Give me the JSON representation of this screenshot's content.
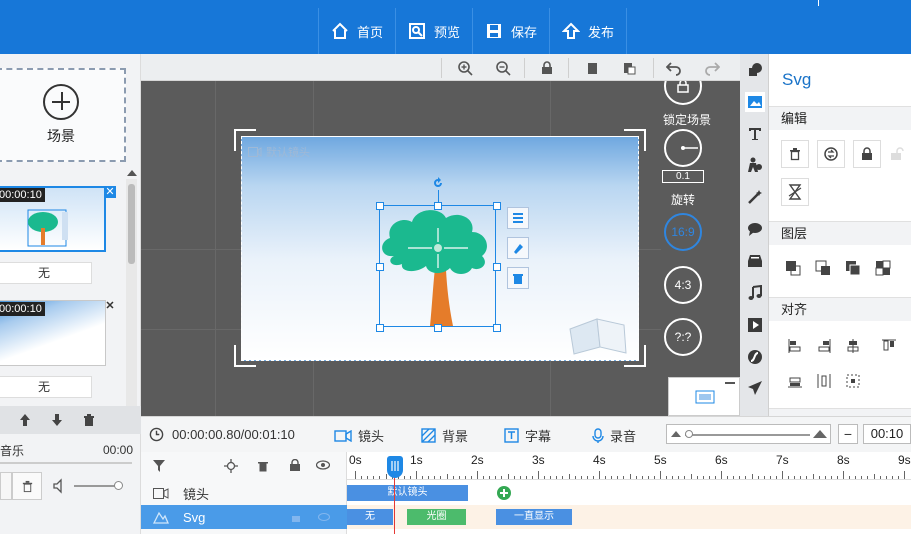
{
  "topbar": {
    "home": "首页",
    "preview": "预览",
    "save": "保存",
    "publish": "发布"
  },
  "left": {
    "add_scene": "场景",
    "scenes": [
      {
        "time": "00:00:10",
        "transition": "无"
      },
      {
        "time": "00:00:10",
        "transition": "无"
      }
    ],
    "music_label": "音乐",
    "music_time": "00:00"
  },
  "canvas": {
    "camera_label": "默认镜头",
    "lock_scene": "锁定场景",
    "rotate_value": "0.1",
    "rotate": "旋转",
    "ratio_169": "16:9",
    "ratio_43": "4:3",
    "ratio_custom": "?:?"
  },
  "right": {
    "title": "Svg",
    "sec_edit": "编辑",
    "sec_layer": "图层",
    "sec_align": "对齐"
  },
  "timeline": {
    "time": "00:00:00.80/00:01:10",
    "tabs": [
      "镜头",
      "背景",
      "字幕",
      "录音"
    ],
    "duration": "00:10",
    "minus": "−",
    "ruler": [
      "0s",
      "1s",
      "2s",
      "3s",
      "4s",
      "5s",
      "6s",
      "7s",
      "8s",
      "9s"
    ],
    "rows": [
      "镜头",
      "Svg"
    ],
    "clips": {
      "camera": "默认镜头",
      "enter": "无",
      "effect": "光圈",
      "exit": "一直显示"
    }
  },
  "colors": {
    "topbar": "#1777d8",
    "accent": "#1e88e5",
    "tree_canopy": "#1bb98f",
    "tree_trunk": "#e57c2a"
  }
}
